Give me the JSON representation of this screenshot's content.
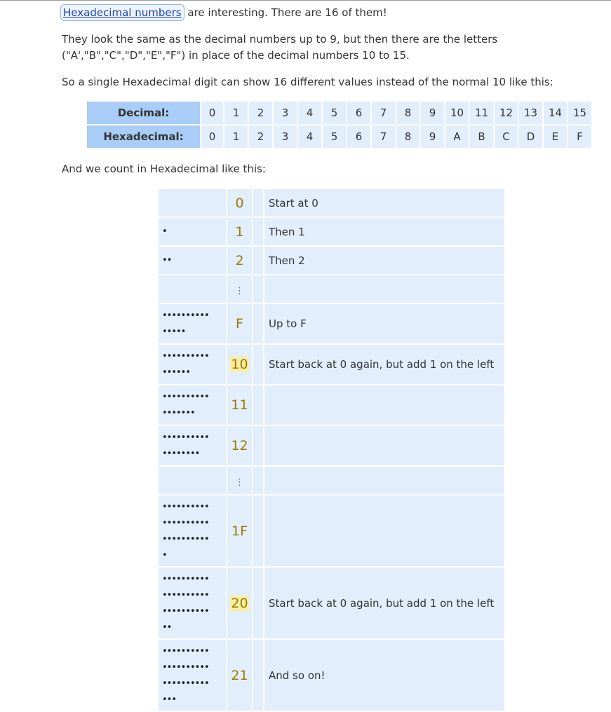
{
  "intro": {
    "link_text": "Hexadecimal numbers",
    "rest": " are interesting. There are 16 of them!"
  },
  "para2": "They look the same as the decimal numbers up to 9, but then there are the letters (\"A',\"B\",\"C\",\"D\",\"E\",\"F\") in place of the decimal numbers 10 to 15.",
  "para3": "So a single Hexadecimal digit can show 16 different values instead of the normal 10 like this:",
  "para4": "And we count in Hexadecimal like this:",
  "dh_table": {
    "decimal_label": "Decimal:",
    "hex_label": "Hexadecimal:",
    "decimal": [
      "0",
      "1",
      "2",
      "3",
      "4",
      "5",
      "6",
      "7",
      "8",
      "9",
      "10",
      "11",
      "12",
      "13",
      "14",
      "15"
    ],
    "hex": [
      "0",
      "1",
      "2",
      "3",
      "4",
      "5",
      "6",
      "7",
      "8",
      "9",
      "A",
      "B",
      "C",
      "D",
      "E",
      "F"
    ]
  },
  "count_rows": [
    {
      "dots": 0,
      "num": "0",
      "desc": "Start at 0",
      "highlight": false
    },
    {
      "dots": 1,
      "num": "1",
      "desc": "Then 1",
      "highlight": false
    },
    {
      "dots": 2,
      "num": "2",
      "desc": "Then 2",
      "highlight": false
    },
    {
      "ellipsis": true
    },
    {
      "dots": 15,
      "num": "F",
      "desc": "Up to F",
      "highlight": false
    },
    {
      "dots": 16,
      "num": "10",
      "desc": "Start back at 0 again, but add 1 on the left",
      "highlight": true
    },
    {
      "dots": 17,
      "num": "11",
      "desc": "",
      "highlight": false
    },
    {
      "dots": 18,
      "num": "12",
      "desc": "",
      "highlight": false
    },
    {
      "ellipsis": true
    },
    {
      "dots": 31,
      "num": "1F",
      "desc": "",
      "highlight": false
    },
    {
      "dots": 32,
      "num": "20",
      "desc": "Start back at 0 again, but add 1 on the left",
      "highlight": true
    },
    {
      "dots": 33,
      "num": "21",
      "desc": "And so on!",
      "highlight": false
    }
  ]
}
